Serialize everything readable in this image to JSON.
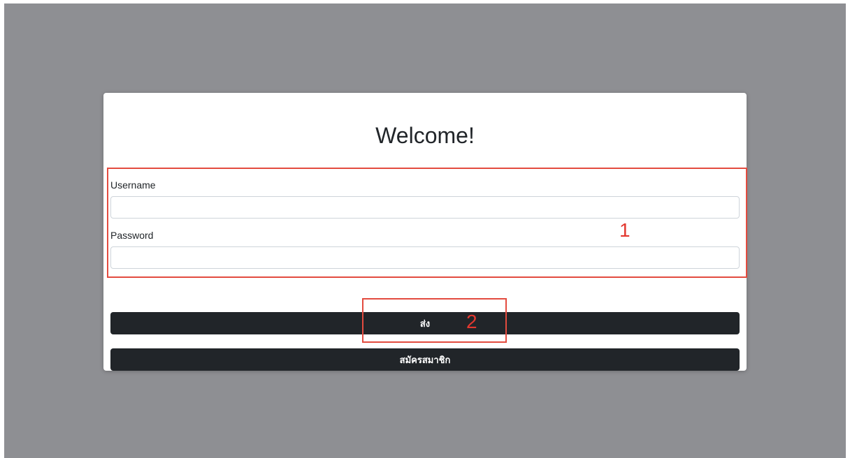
{
  "login": {
    "title": "Welcome!",
    "username_label": "Username",
    "username_value": "",
    "password_label": "Password",
    "password_value": "",
    "submit_label": "ส่ง",
    "register_label": "สมัครสมาชิก"
  },
  "annotations": {
    "box1_number": "1",
    "box2_number": "2"
  },
  "colors": {
    "overlay": "#8e8f93",
    "button": "#212529",
    "annotation": "#e3382f"
  }
}
